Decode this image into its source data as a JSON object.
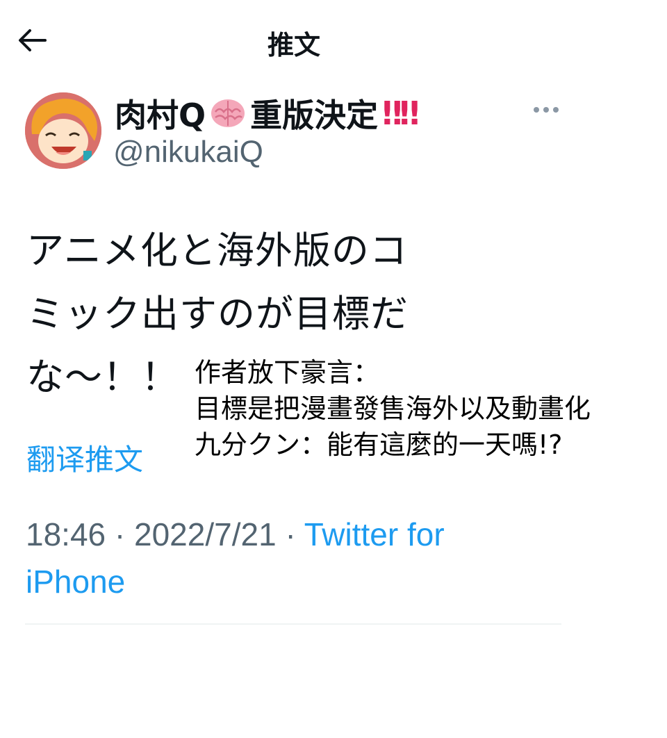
{
  "header": {
    "back_icon": "arrow-left-icon",
    "title": "推文"
  },
  "tweet": {
    "avatar_icon": "avatar",
    "display_name_part1": "肉村Q",
    "display_name_emoji": "brain-emoji",
    "display_name_part2": "重版決定",
    "display_name_bangs": "‼‼",
    "handle": "@nikukaiQ",
    "more_icon": "more-horizontal-icon",
    "text_lines": [
      "アニメ化と海外版のコ",
      "ミック出すのが目標だ",
      "な〜！！"
    ],
    "translate_label": "翻译推文",
    "time": "18:46",
    "separator": "·",
    "date": "2022/7/21",
    "source_line1": "Twitter for",
    "source_line2": "iPhone"
  },
  "overlay_caption": {
    "lines": [
      "作者放下豪言：",
      "目標是把漫畫發售海外以及動畫化",
      "九分クン：能有這麼的一天嗎!?"
    ]
  },
  "colors": {
    "accent": "#1d9bf0",
    "secondary_text": "#536471",
    "primary_text": "#0f1419",
    "bang_red": "#e0245e"
  }
}
